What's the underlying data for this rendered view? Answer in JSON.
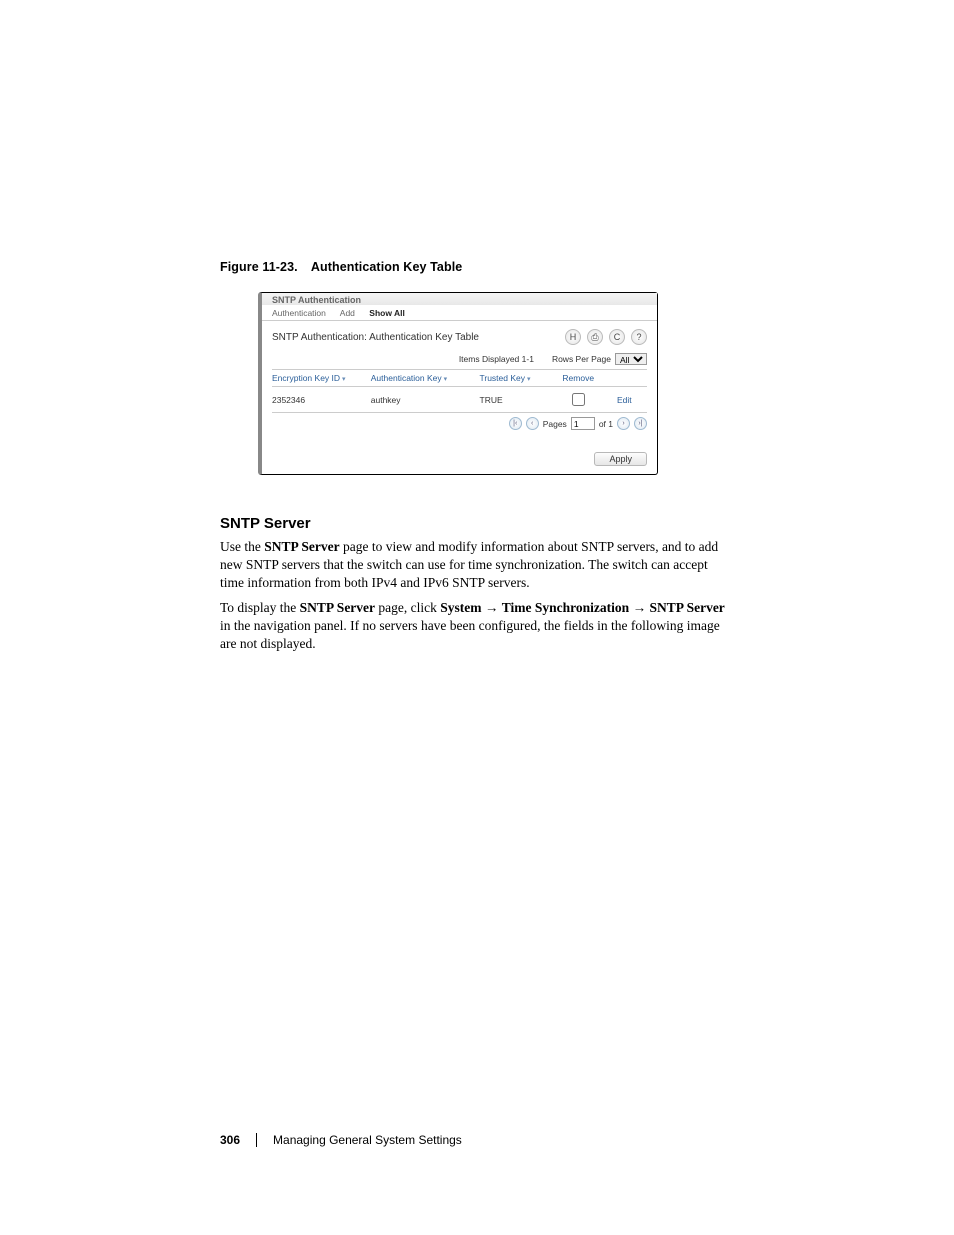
{
  "figure": {
    "num": "Figure 11-23.",
    "title": "Authentication Key Table"
  },
  "screenshot": {
    "window_title": "SNTP Authentication",
    "tabs": {
      "t1": "Authentication",
      "t2": "Add",
      "t3": "Show All"
    },
    "page_title": "SNTP Authentication: Authentication Key Table",
    "icons": {
      "save": "H",
      "print": "⎙",
      "refresh": "C",
      "help": "?"
    },
    "meta": {
      "items_displayed": "Items Displayed 1-1",
      "rows_per_page_label": "Rows Per Page",
      "rows_per_page_value": "All"
    },
    "columns": {
      "c1": "Encryption Key ID",
      "c2": "Authentication Key",
      "c3": "Trusted Key",
      "c4": "Remove",
      "c5": ""
    },
    "rows": [
      {
        "c1": "2352346",
        "c2": "authkey",
        "c3": "TRUE",
        "edit": "Edit"
      }
    ],
    "pager": {
      "pages_label": "Pages",
      "page_value": "1",
      "of_label": "of 1"
    },
    "apply": "Apply"
  },
  "section": {
    "title": "SNTP Server"
  },
  "para1": {
    "pre": "Use the ",
    "b1": "SNTP Server",
    "post": " page to view and modify information about SNTP servers, and to add new SNTP servers that the switch can use for time synchronization. The switch can accept time information from both IPv4 and IPv6 SNTP servers."
  },
  "para2": {
    "pre": "To display the ",
    "b1": "SNTP Server",
    "mid1": " page, click ",
    "b2": "System",
    "arrow": " → ",
    "b3": "Time Synchronization",
    "b4": "SNTP Server",
    "post": " in the navigation panel. If no servers have been configured, the fields in the following image are not displayed."
  },
  "footer": {
    "page": "306",
    "chapter": "Managing General System Settings"
  }
}
